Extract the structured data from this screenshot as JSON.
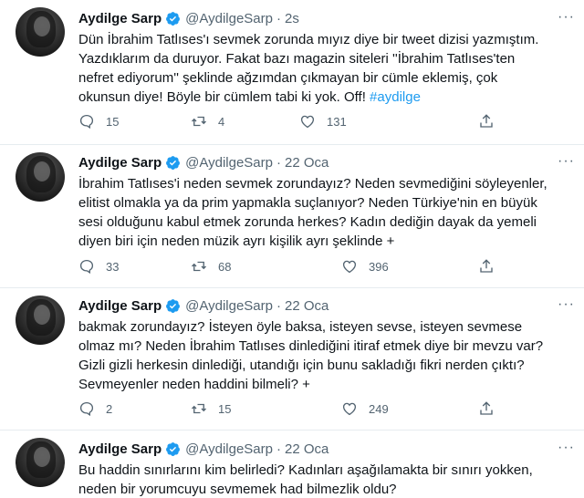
{
  "tweets": [
    {
      "name": "Aydilge Sarp",
      "handle": "@AydilgeSarp",
      "time": "2s",
      "lines": [
        "Dün İbrahim Tatlıses'ı sevmek zorunda mıyız diye bir tweet dizisi yazmıştım.",
        "Yazdıklarım da duruyor. Fakat bazı magazin siteleri ''İbrahim Tatlıses'ten",
        "nefret ediyorum'' şeklinde ağzımdan çıkmayan bir cümle eklemiş, çok",
        "okunsun diye! Böyle bir cümlem tabi ki yok. Off!"
      ],
      "hashtag": "#aydilge",
      "replies": "15",
      "retweets": "4",
      "likes": "131"
    },
    {
      "name": "Aydilge Sarp",
      "handle": "@AydilgeSarp",
      "time": "22 Oca",
      "lines": [
        "İbrahim Tatlıses'i neden sevmek zorundayız? Neden sevmediğini söyleyenler,",
        "elitist olmakla ya da prim yapmakla suçlanıyor? Neden Türkiye'nin en büyük",
        "sesi olduğunu kabul etmek zorunda herkes? Kadın dediğin dayak da yemeli",
        "diyen biri için neden müzik ayrı kişilik ayrı şeklinde +"
      ],
      "replies": "33",
      "retweets": "68",
      "likes": "396"
    },
    {
      "name": "Aydilge Sarp",
      "handle": "@AydilgeSarp",
      "time": "22 Oca",
      "lines": [
        "bakmak zorundayız? İsteyen öyle baksa, isteyen sevse, isteyen sevmese",
        "olmaz mı? Neden İbrahim Tatlıses dinlediğini itiraf etmek diye bir mevzu var?",
        "Gizli gizli herkesin dinlediği, utandığı için bunu sakladığı fikri nerden çıktı?",
        "Sevmeyenler neden haddini bilmeli? +"
      ],
      "replies": "2",
      "retweets": "15",
      "likes": "249"
    },
    {
      "name": "Aydilge Sarp",
      "handle": "@AydilgeSarp",
      "time": "22 Oca",
      "lines": [
        "Bu haddin sınırlarını kim belirledi? Kadınları aşağılamakta bir sınırı yokken,",
        "neden bir yorumcuyu sevmemek had bilmezlik oldu?"
      ]
    }
  ],
  "separator_dot": "·",
  "more_glyph": "···",
  "colors": {
    "accent": "#1d9bf0",
    "secondary_text": "#536471",
    "divider": "#e6ecf0"
  },
  "icons": [
    "verified-badge-icon",
    "reply-icon",
    "retweet-icon",
    "like-icon",
    "share-icon",
    "more-icon"
  ]
}
